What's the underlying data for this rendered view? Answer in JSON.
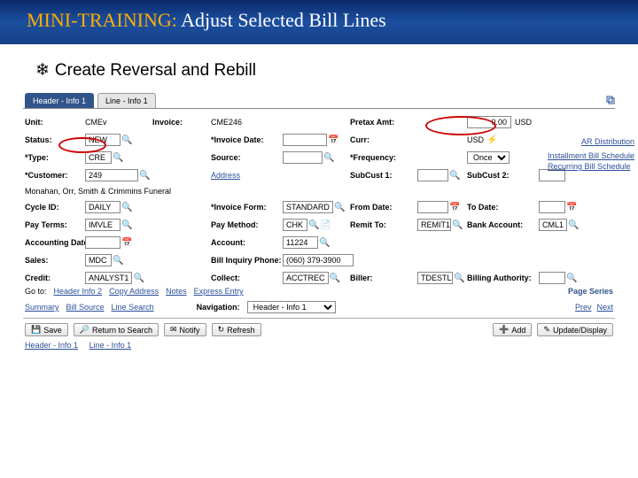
{
  "banner": {
    "highlight": "MINI-TRAINING:",
    "rest": " Adjust Selected Bill Lines"
  },
  "subhead": {
    "bullet": "❄",
    "text": "Create Reversal and Rebill"
  },
  "tabs": {
    "active": "Header - Info 1",
    "other": "Line - Info 1"
  },
  "rightlinks": {
    "ar": "AR Distribution",
    "inst": "Installment Bill Schedule",
    "recur": "Recurring Bill Schedule"
  },
  "row1": {
    "unit_lbl": "Unit:",
    "unit_val": "CMEv",
    "invoice_lbl": "Invoice:",
    "invoice_val": "CME246",
    "pretax_lbl": "Pretax Amt:",
    "pretax_amt": "0.00",
    "pretax_ccy": "USD"
  },
  "row2": {
    "status_lbl": "Status:",
    "status_val": "NEW",
    "invdate_lbl": "Invoice Date:",
    "curr_lbl": "Curr:",
    "curr_val": "USD"
  },
  "row3": {
    "type_lbl": "Type:",
    "type_val": "CRE",
    "source_lbl": "Source:",
    "freq_lbl": "Frequency:",
    "freq_val": "Once"
  },
  "row4": {
    "cust_lbl": "Customer:",
    "cust_val": "249",
    "addr_link": "Address",
    "subcust1_lbl": "SubCust 1:",
    "subcust2_lbl": "SubCust 2:"
  },
  "row5": {
    "name": "Monahan, Orr, Smith & Crimmins Funeral"
  },
  "row6": {
    "cycle_lbl": "Cycle ID:",
    "cycle_val": "DAILY",
    "invform_lbl": "Invoice Form:",
    "invform_val": "STANDARD",
    "fromdate_lbl": "From Date:",
    "todate_lbl": "To Date:"
  },
  "row7": {
    "payterms_lbl": "Pay Terms:",
    "payterms_val": "IMVLE",
    "paymethod_lbl": "Pay Method:",
    "paymethod_val": "CHK",
    "remitto_lbl": "Remit To:",
    "remitto_val": "REMIT1",
    "bankacct_lbl": "Bank Account:",
    "bankacct_val": "CML1"
  },
  "row8": {
    "acctdate_lbl": "Accounting Date:",
    "account_lbl": "Account:",
    "account_val": "11224"
  },
  "row9": {
    "sales_lbl": "Sales:",
    "sales_val": "MDC",
    "billphone_lbl": "Bill Inquiry Phone:",
    "billphone_val": "(060) 379-3900"
  },
  "row10": {
    "credit_lbl": "Credit:",
    "credit_val": "ANALYST1",
    "collect_lbl": "Collect:",
    "collect_val": "ACCTREC",
    "biller_lbl": "Biller:",
    "biller_val": "TDESTL",
    "billauth_lbl": "Billing Authority:"
  },
  "goto": {
    "goto": "Go to:",
    "headerinfo2": "Header Info 2",
    "copyaddr": "Copy Address",
    "notes": "Notes",
    "express": "Express Entry",
    "pageser": "Page Series",
    "prev": "Prev",
    "next": "Next"
  },
  "summary": {
    "summary": "Summary",
    "billsrc": "Bill Source",
    "linesearch": "Line Search",
    "nav_lbl": "Navigation:",
    "nav_val": "Header - Info 1"
  },
  "toolbar": {
    "save": "Save",
    "return": "Return to Search",
    "notify": "Notify",
    "refresh": "Refresh",
    "add": "Add",
    "update": "Update/Display"
  },
  "bottomtabs": {
    "t1": "Header - Info 1",
    "t2": "Line - Info 1"
  }
}
